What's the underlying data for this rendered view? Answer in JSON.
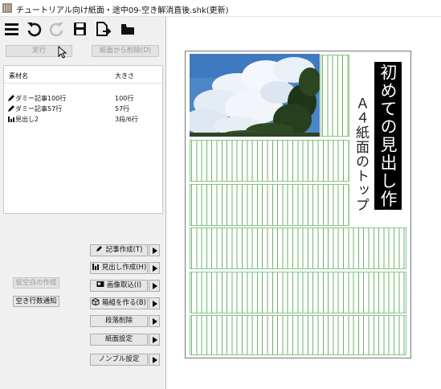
{
  "window": {
    "title": "チュートリアル向け紙面・途中09-空き解消直後.shk(更新)"
  },
  "toolbar": {
    "icons": [
      "menu-icon",
      "undo-icon",
      "redo-icon",
      "save-icon",
      "export-icon",
      "open-folder-icon"
    ]
  },
  "actions": {
    "run_label": "実行",
    "remove_label": "紙面から削除(D)"
  },
  "materials": {
    "header_name": "素材名",
    "header_size": "大きさ",
    "rows": [
      {
        "icon": "pencil-icon",
        "name": "ダミー記事100行",
        "size": "100行"
      },
      {
        "icon": "pencil-icon",
        "name": "ダミー記事57行",
        "size": "57行"
      },
      {
        "icon": "bar-chart-icon",
        "name": "見出し2",
        "size": "3段/6行"
      }
    ]
  },
  "left_buttons": {
    "fake_blank": "仮空白の作成",
    "notify_blank": "空き行数通知"
  },
  "side_buttons": {
    "article": "記事作成(T)",
    "heading": "見出し作成(H)",
    "image": "画像取込(I)",
    "box": "箱組を作る(B)",
    "delete_section": "段落削除",
    "page_settings": "紙面設定",
    "nonbull_settings": "ノンブル設定"
  },
  "page": {
    "headline": "初めての見出し作り",
    "subtitle": "Ａ４紙面のトップ"
  },
  "colors": {
    "column_rule": "#6cb36c",
    "headline_bg": "#000000",
    "sky": "#4d86c6"
  }
}
